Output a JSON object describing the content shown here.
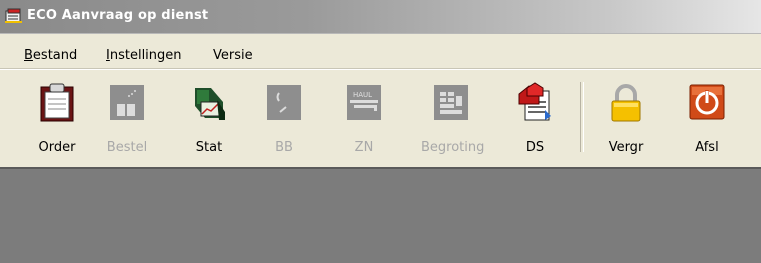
{
  "window": {
    "title": "ECO Aanvraag op dienst"
  },
  "menu": {
    "items": [
      {
        "mnemonic": "B",
        "rest": "estand"
      },
      {
        "mnemonic": "I",
        "rest": "nstellingen"
      },
      {
        "mnemonic": "",
        "rest": "Versie"
      }
    ]
  },
  "toolbar": {
    "buttons": [
      {
        "label": "Order",
        "icon": "clipboard-icon",
        "enabled": true
      },
      {
        "label": "Bestel",
        "icon": "order-icon",
        "enabled": false
      },
      {
        "label": "Stat",
        "icon": "chart-icon",
        "enabled": true
      },
      {
        "label": "BB",
        "icon": "bb-icon",
        "enabled": false
      },
      {
        "label": "ZN",
        "icon": "haul-icon",
        "enabled": false
      },
      {
        "label": "Begroting",
        "icon": "budget-icon",
        "enabled": false
      },
      {
        "label": "DS",
        "icon": "document-icon",
        "enabled": true
      },
      {
        "label": "Vergr",
        "icon": "lock-icon",
        "enabled": true
      },
      {
        "label": "Afsl",
        "icon": "power-icon",
        "enabled": true
      }
    ]
  },
  "colors": {
    "window_bg": "#ece9d8",
    "content_bg": "#7c7c7c",
    "disabled_text": "#a8a8a8"
  }
}
